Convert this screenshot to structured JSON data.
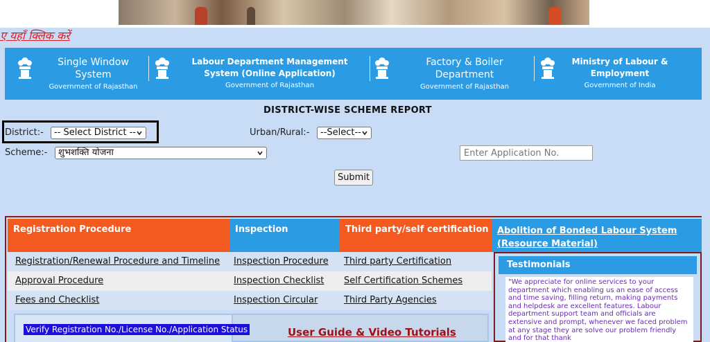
{
  "top": {
    "click_here_text": "ए यहाँ क्लिक करें"
  },
  "header_links": [
    {
      "title": "Single Window System",
      "subtitle": "Government of Rajasthan"
    },
    {
      "title": "Labour Department Management System (Online Application)",
      "subtitle": "Government of Rajasthan"
    },
    {
      "title": "Factory & Boiler Department",
      "subtitle": "Government of Rajasthan"
    },
    {
      "title": "Ministry of Labour & Employment",
      "subtitle": "Government of India"
    }
  ],
  "report": {
    "title": "DISTRICT-WISE SCHEME REPORT",
    "district_label": "District:-",
    "district_value": "-- Select District --",
    "urban_rural_label": "Urban/Rural:-",
    "urban_rural_value": "--Select--",
    "scheme_label": "Scheme:-",
    "scheme_value": "शुभशक्ति योजना",
    "application_placeholder": "Enter Application No.",
    "submit_label": "Submit"
  },
  "sections": {
    "headers": [
      "Registration Procedure",
      "Inspection",
      "Third party/self certification",
      "Abolition of Bonded Labour System (Resource Material)"
    ],
    "rows": [
      [
        "Registration/Renewal Procedure and Timeline",
        "Inspection Procedure",
        "Third party Certification"
      ],
      [
        "Approval Procedure",
        "Inspection Checklist",
        "Self Certification Schemes"
      ],
      [
        "Fees and Checklist",
        "Inspection Circular",
        "Third Party Agencies"
      ]
    ]
  },
  "verify_label": "Verify Registration No./License No./Application Status",
  "user_guide_label": "User Guide & Video Tutorials",
  "testimonials": {
    "title": "Testimonials",
    "text": "\"We appreciate for online services to your department which enabling us an ease of access and time saving, filling return, making payments and helpdesk are excellent features. Labour department support team and officials are extensive and prompt, whenever we faced problem at any stage they are solve our problem friendly and for that thank"
  },
  "colors": {
    "blue": "#2b9be4",
    "orange": "#f25a1f",
    "page_bg": "#c9dcf6",
    "maroon": "#8b1a1a"
  }
}
